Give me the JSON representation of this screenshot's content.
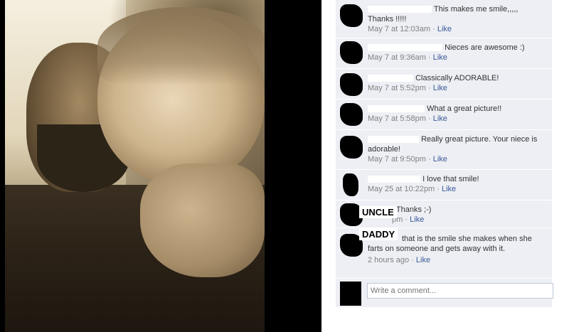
{
  "comments": [
    {
      "text": "This makes me smile,,,,,",
      "text2": "Thanks !!!!!",
      "time": "May 7 at 12:03am",
      "sep": "·",
      "like": "Like"
    },
    {
      "text": "Nieces are awesome :)",
      "time": "May 7 at 9:36am",
      "sep": "·",
      "like": "Like"
    },
    {
      "text": "Classically ADORABLE!",
      "time": "May 7 at 5:52pm",
      "sep": "·",
      "like": "Like"
    },
    {
      "text": "What a great picture!!",
      "time": "May 7 at 5:58pm",
      "sep": "·",
      "like": "Like"
    },
    {
      "text": "Really great picture. Your niece is adorable!",
      "time": "May 7 at 9:50pm",
      "sep": "·",
      "like": "Like"
    },
    {
      "text": "I love that smile!",
      "time": "May 25 at 10:22pm",
      "sep": "·",
      "like": "Like"
    },
    {
      "text": ": Thanks ;-)",
      "time": "pm",
      "sep": "·",
      "like": "Like"
    },
    {
      "text": "that is the smile she makes when she farts on someone and gets away with it.",
      "time": "2 hours ago",
      "sep": "·",
      "like": "Like"
    }
  ],
  "tags": {
    "uncle": "UNCLE",
    "daddy": "DADDY"
  },
  "write_comment": {
    "placeholder": "Write a comment..."
  }
}
